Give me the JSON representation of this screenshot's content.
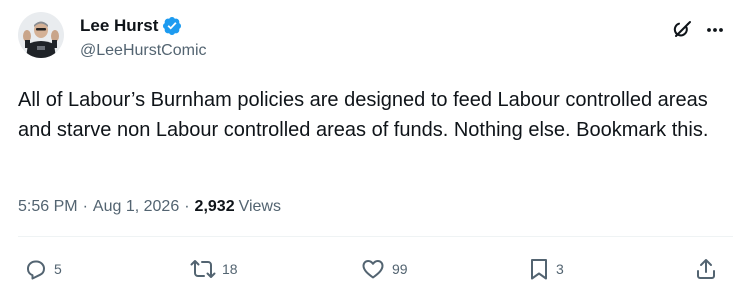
{
  "author": {
    "display_name": "Lee Hurst",
    "handle": "@LeeHurstComic",
    "verified": true
  },
  "tweet": {
    "text": "All of Labour’s Burnham policies are designed to feed Labour controlled areas and starve non Labour controlled areas of funds. Nothing else. Bookmark this."
  },
  "meta": {
    "time": "5:56 PM",
    "separator": "·",
    "date": "Aug 1, 2026",
    "views_count": "2,932",
    "views_label": "Views"
  },
  "actions": {
    "replies": "5",
    "reposts": "18",
    "likes": "99",
    "bookmarks": "3"
  },
  "icons": {
    "verified": "verified-badge-icon",
    "grok": "grok-icon",
    "more": "more-icon",
    "reply": "reply-icon",
    "repost": "repost-icon",
    "like": "heart-icon",
    "bookmark": "bookmark-icon",
    "share": "share-icon"
  },
  "colors": {
    "text_primary": "#0f1419",
    "text_secondary": "#536471",
    "verified_blue": "#1d9bf0",
    "divider": "#eff3f4"
  }
}
